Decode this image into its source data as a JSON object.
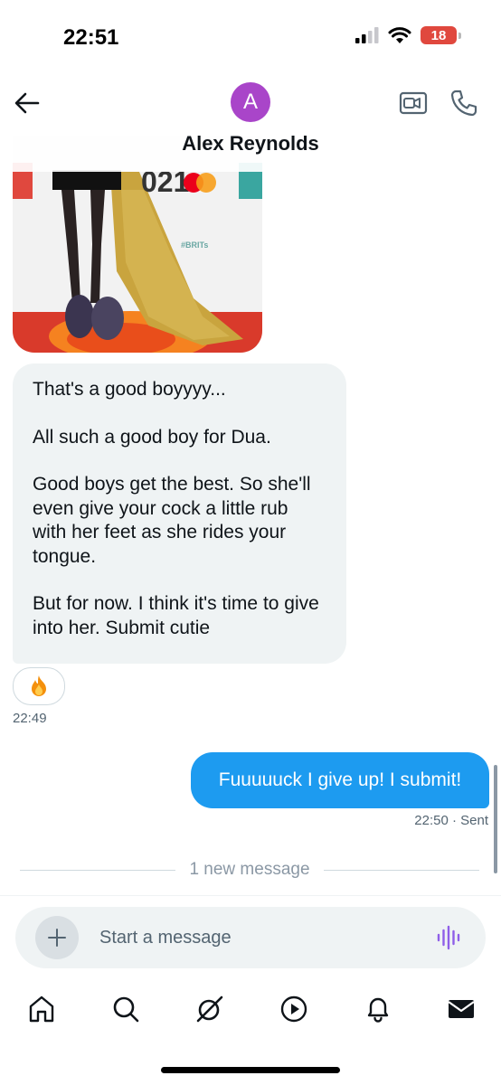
{
  "status_bar": {
    "time": "22:51",
    "battery": "18"
  },
  "header": {
    "avatar_letter": "A",
    "contact_name": "Alex Reynolds"
  },
  "media": {
    "banner_text": "021",
    "hashtag": "#BRITs"
  },
  "incoming_message": {
    "paragraphs": [
      "That's a good boyyyy...",
      "All such a good boy for Dua.",
      "Good boys get the best. So she'll even give your cock a little rub with her feet as she rides your tongue.",
      "But for now. I think it's time to give into her. Submit cutie"
    ],
    "reaction": "🔥",
    "timestamp": "22:49"
  },
  "outgoing_message": {
    "text": "Fuuuuuck I give up! I submit!",
    "timestamp": "22:50 · Sent"
  },
  "divider": {
    "text": "1 new message"
  },
  "composer": {
    "placeholder": "Start a message"
  },
  "tabbar": {
    "icons": [
      "home-icon",
      "search-icon",
      "grok-icon",
      "video-icon",
      "notifications-icon",
      "messages-icon"
    ]
  },
  "colors": {
    "accent": "#1d9bf0",
    "avatar": "#a945c9",
    "voice": "#8f5fe8",
    "battery": "#e0483e"
  }
}
